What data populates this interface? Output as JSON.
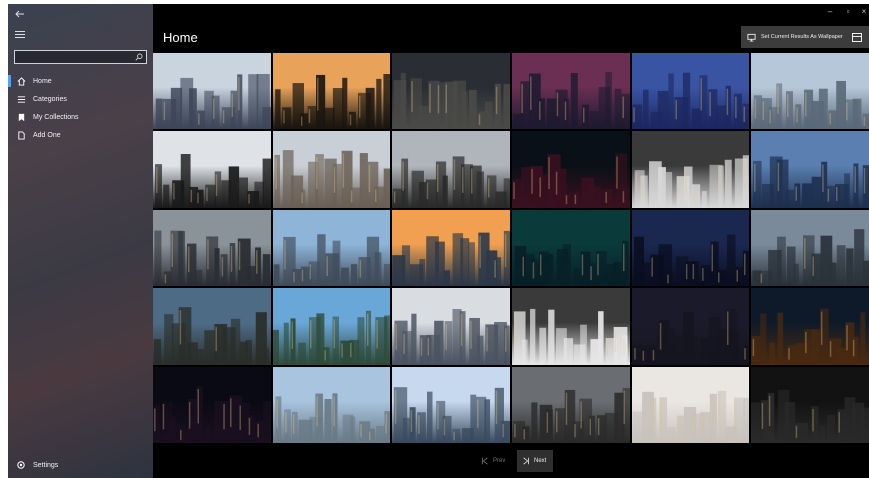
{
  "sidebar": {
    "search": {
      "value": "",
      "placeholder": ""
    },
    "items": [
      {
        "label": "Home",
        "icon": "home-icon",
        "active": true
      },
      {
        "label": "Categories",
        "icon": "list-icon"
      },
      {
        "label": "My Collections",
        "icon": "bookmark-icon"
      },
      {
        "label": "Add One",
        "icon": "document-icon"
      }
    ],
    "settings_label": "Settings"
  },
  "header": {
    "title": "Home",
    "wallpaper_button": "Set Current Results As Wallpaper"
  },
  "pager": {
    "prev_label": "Prev",
    "next_label": "Next"
  },
  "gallery": {
    "tiles": [
      {
        "sky": "#c9d4df",
        "ground": "#3d4658",
        "subject": "city-skyline"
      },
      {
        "sky": "#e8a25a",
        "ground": "#1a1510",
        "subject": "skyline-sunset"
      },
      {
        "sky": "#2a2e34",
        "ground": "#4a4a48",
        "subject": "aerial-intersection"
      },
      {
        "sky": "#6a2f52",
        "ground": "#1e1a30",
        "subject": "city-dusk"
      },
      {
        "sky": "#3a54a4",
        "ground": "#1c2860",
        "subject": "aerial-night"
      },
      {
        "sky": "#b6c7d9",
        "ground": "#5a6878",
        "subject": "city-skyline"
      },
      {
        "sky": "#dfe3e8",
        "ground": "#1a1a1a",
        "subject": "skyscrapers-looking-up"
      },
      {
        "sky": "#c8cfd6",
        "ground": "#6a5f55",
        "subject": "city-skyline"
      },
      {
        "sky": "#b0b5bb",
        "ground": "#2a2a2a",
        "subject": "street-canyon"
      },
      {
        "sky": "#0a1018",
        "ground": "#3a1020",
        "subject": "bokeh-lights"
      },
      {
        "sky": "#3a3a3a",
        "ground": "#d8d8d8",
        "subject": "building-facade"
      },
      {
        "sky": "#5a7fb0",
        "ground": "#1e3050",
        "subject": "waterfront-skyline"
      },
      {
        "sky": "#8a929a",
        "ground": "#2a2e34",
        "subject": "aerial-city"
      },
      {
        "sky": "#8eb4d8",
        "ground": "#404c5a",
        "subject": "city-skyline"
      },
      {
        "sky": "#f0a050",
        "ground": "#2c3848",
        "subject": "sunrise-city"
      },
      {
        "sky": "#0a3a3a",
        "ground": "#082028",
        "subject": "night-harbour"
      },
      {
        "sky": "#1a2850",
        "ground": "#0a0e20",
        "subject": "night-skyline"
      },
      {
        "sky": "#7a8a9a",
        "ground": "#2a323a",
        "subject": "tower-skyline"
      },
      {
        "sky": "#4e6b86",
        "ground": "#2a2e2a",
        "subject": "aerial-city"
      },
      {
        "sky": "#6aa7d9",
        "ground": "#2e4a3a",
        "subject": "city-clouds"
      },
      {
        "sky": "#d9dde2",
        "ground": "#4a5360",
        "subject": "waterfront"
      },
      {
        "sky": "#3a3a3a",
        "ground": "#e6e6e6",
        "subject": "crosswalk"
      },
      {
        "sky": "#1a1a2a",
        "ground": "#151520",
        "subject": "night-traffic"
      },
      {
        "sky": "#0e1a2a",
        "ground": "#4a2a10",
        "subject": "bridge-night"
      },
      {
        "sky": "#0a0a14",
        "ground": "#1a1020",
        "subject": "night-towers"
      },
      {
        "sky": "#a8c4de",
        "ground": "#6a7a86",
        "subject": "hazy-city"
      },
      {
        "sky": "#c6d9ef",
        "ground": "#3a4a5e",
        "subject": "city-skyline"
      },
      {
        "sky": "#6a6e72",
        "ground": "#2a2a2a",
        "subject": "street-canyon"
      },
      {
        "sky": "#eae6e2",
        "ground": "#c8c2bc",
        "subject": "foggy-towers"
      },
      {
        "sky": "#121212",
        "ground": "#2a2a2a",
        "subject": "bw-skyline"
      }
    ]
  }
}
